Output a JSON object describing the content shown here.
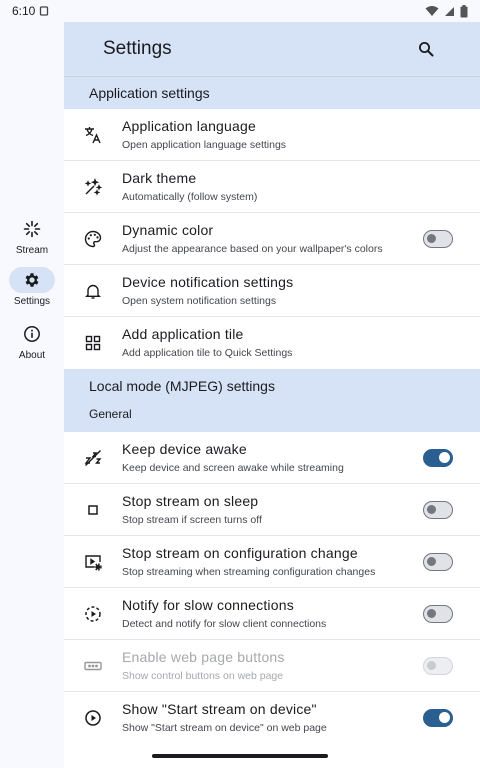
{
  "status": {
    "time": "6:10"
  },
  "rail": {
    "items": [
      {
        "label": "Stream",
        "icon": "stream-icon"
      },
      {
        "label": "Settings",
        "icon": "gear-icon",
        "active": true
      },
      {
        "label": "About",
        "icon": "info-icon"
      }
    ]
  },
  "topbar": {
    "title": "Settings"
  },
  "app_section": {
    "header": "Application settings",
    "rows": [
      {
        "title": "Application language",
        "subtitle": "Open application language settings",
        "icon": "translate-icon"
      },
      {
        "title": "Dark theme",
        "subtitle": "Automatically (follow system)",
        "icon": "dark-theme-icon"
      },
      {
        "title": "Dynamic color",
        "subtitle": "Adjust the appearance based on your wallpaper's colors",
        "icon": "palette-icon",
        "switch": "off"
      },
      {
        "title": "Device notification settings",
        "subtitle": "Open system notification settings",
        "icon": "bell-icon"
      },
      {
        "title": "Add application tile",
        "subtitle": "Add application tile to Quick Settings",
        "icon": "grid-icon"
      }
    ]
  },
  "local_section": {
    "header": "Local mode (MJPEG) settings",
    "subheader": "General",
    "rows": [
      {
        "title": "Keep device awake",
        "subtitle": "Keep device and screen awake while streaming",
        "icon": "sleep-off-icon",
        "switch": "on"
      },
      {
        "title": "Stop stream on sleep",
        "subtitle": "Stop stream if screen turns off",
        "icon": "stop-icon",
        "switch": "off"
      },
      {
        "title": "Stop stream on configuration change",
        "subtitle": "Stop streaming when streaming configuration changes",
        "icon": "screen-settings-icon",
        "switch": "off"
      },
      {
        "title": "Notify for slow connections",
        "subtitle": "Detect and notify for slow client connections",
        "icon": "slow-connection-icon",
        "switch": "off"
      },
      {
        "title": "Enable web page buttons",
        "subtitle": "Show control buttons on web page",
        "icon": "buttons-icon",
        "switch": "disabled"
      },
      {
        "title": "Show \"Start stream on device\"",
        "subtitle": "Show \"Start stream on device\" on web page",
        "icon": "play-circle-icon",
        "switch": "on"
      }
    ]
  },
  "colors": {
    "accent": "#2c5f91",
    "header_bg": "#d6e3f6"
  }
}
